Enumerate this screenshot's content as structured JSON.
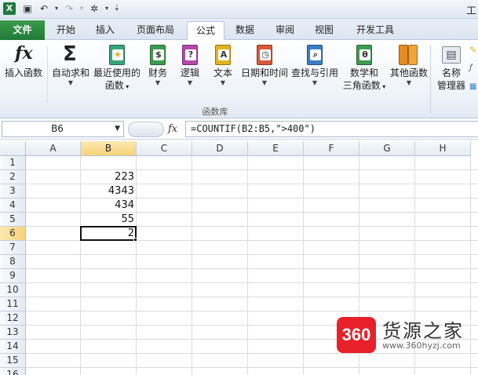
{
  "qat": {
    "app_icon": "X",
    "title": "工"
  },
  "tabs": [
    {
      "label": "文件"
    },
    {
      "label": "开始"
    },
    {
      "label": "插入"
    },
    {
      "label": "页面布局"
    },
    {
      "label": "公式"
    },
    {
      "label": "数据"
    },
    {
      "label": "审阅"
    },
    {
      "label": "视图"
    },
    {
      "label": "开发工具"
    }
  ],
  "active_tab": "公式",
  "ribbon": {
    "buttons": [
      {
        "label": "插入函数",
        "glyph": "fx"
      },
      {
        "label": "自动求和",
        "glyph": "Σ",
        "arrow": "▼"
      },
      {
        "label": "最近使用的",
        "label2": "函数",
        "glyph": "★",
        "arrow": "▼",
        "color": "#3aa37a"
      },
      {
        "label": "财务",
        "glyph": "$",
        "arrow": "▼",
        "color": "#3e9b4f"
      },
      {
        "label": "逻辑",
        "glyph": "?",
        "arrow": "▼",
        "color": "#b548a8"
      },
      {
        "label": "文本",
        "glyph": "A",
        "arrow": "▼",
        "color": "#e3b21f"
      },
      {
        "label": "日期和时间",
        "glyph": "◷",
        "arrow": "▼",
        "color": "#d9573a"
      },
      {
        "label": "查找与引用",
        "glyph": "⌕",
        "arrow": "▼",
        "color": "#3a7fc4"
      },
      {
        "label": "数学和",
        "label2": "三角函数",
        "glyph": "θ",
        "arrow": "▼",
        "color": "#3e9b4f"
      },
      {
        "label": "其他函数",
        "glyph": "",
        "arrow": "▼",
        "color": "#e88a1e"
      },
      {
        "label": "名称",
        "label2": "管理器",
        "glyph": "▤"
      }
    ],
    "group_label": "函数库"
  },
  "formula_bar": {
    "name_box": "B6",
    "fx_label": "fx",
    "formula": "=COUNTIF(B2:B5,\">400\")"
  },
  "sheet": {
    "columns": [
      "A",
      "B",
      "C",
      "D",
      "E",
      "F",
      "G",
      "H"
    ],
    "selected_column": "B",
    "rows": [
      "1",
      "2",
      "3",
      "4",
      "5",
      "6",
      "7",
      "8",
      "9",
      "10",
      "11",
      "12",
      "13",
      "14",
      "15",
      "16"
    ],
    "selected_row": "6",
    "active_cell": "B6",
    "cells": {
      "B2": "223",
      "B3": "4343",
      "B4": "434",
      "B5": "55",
      "B6": "2"
    }
  },
  "watermark": {
    "badge": "360",
    "name": "货源之家",
    "url": "www.360hyzj.com"
  }
}
